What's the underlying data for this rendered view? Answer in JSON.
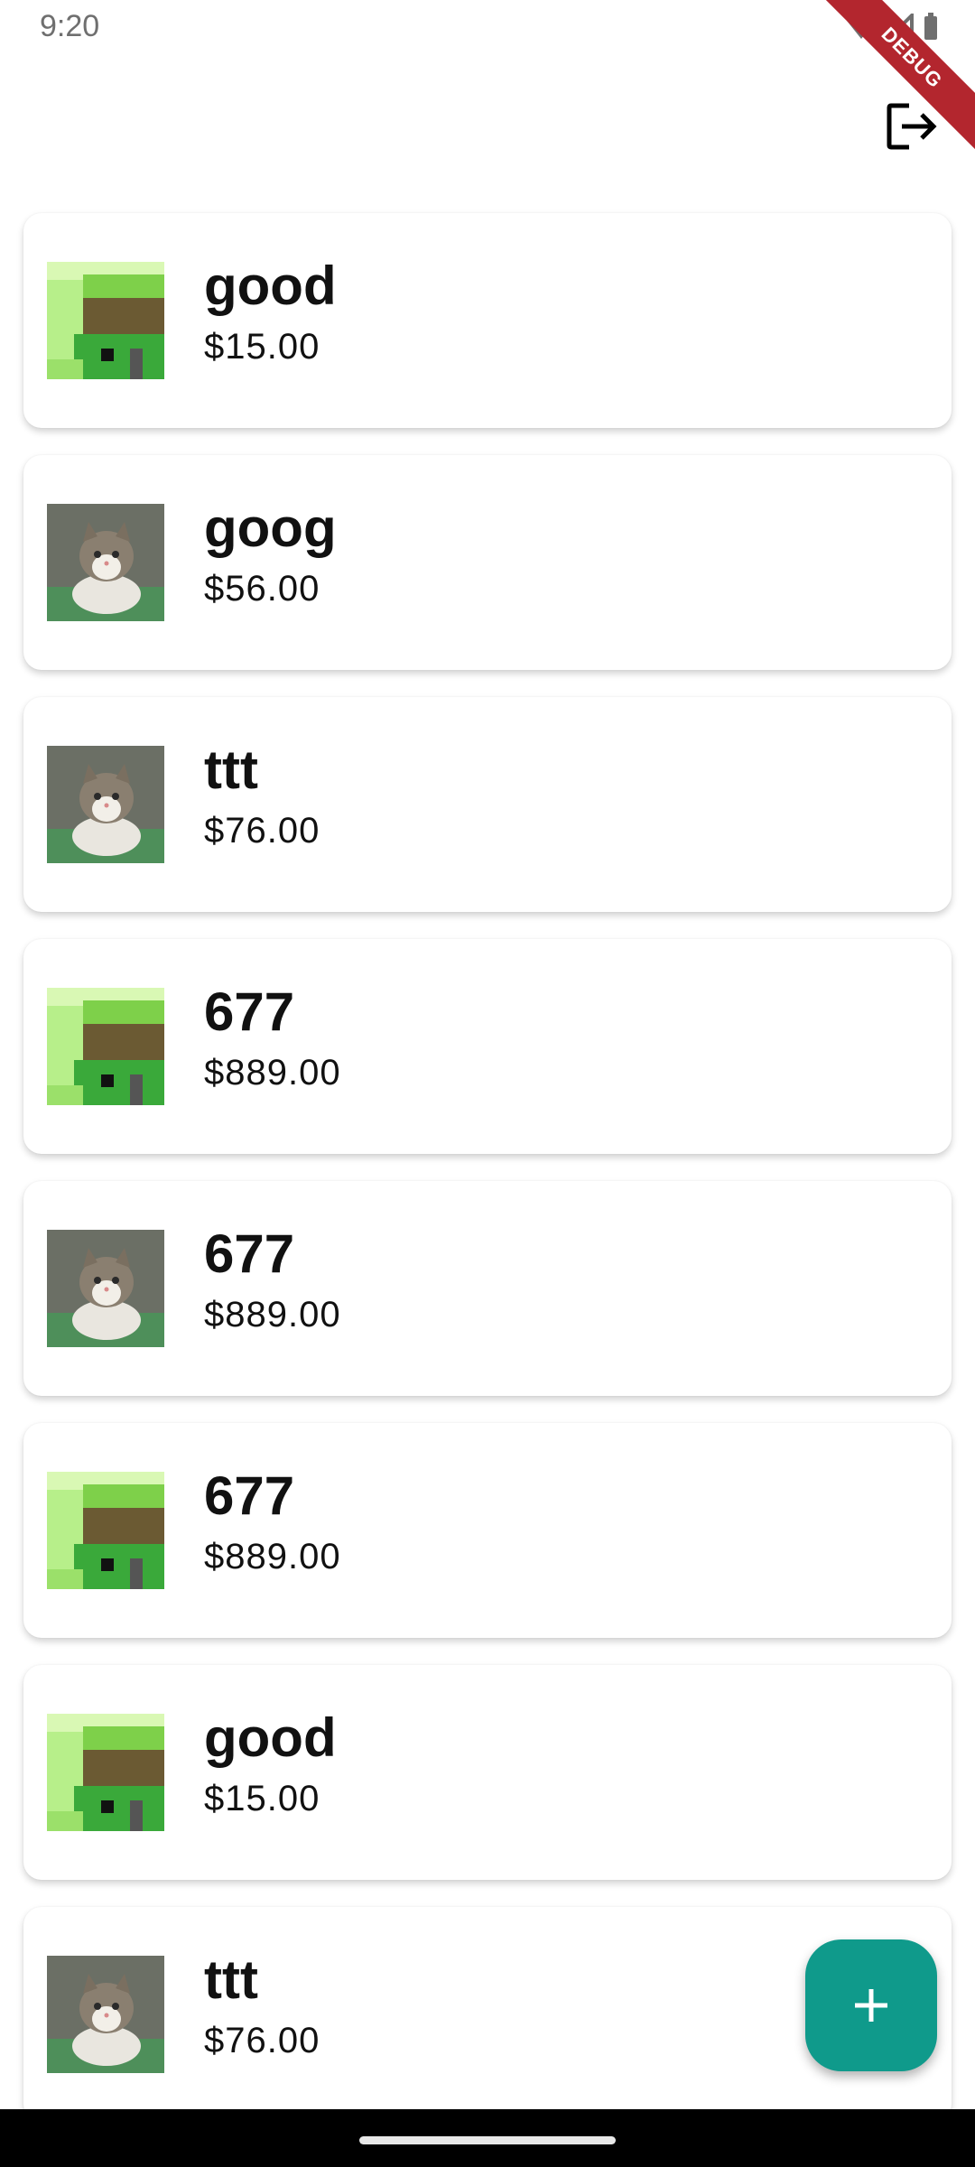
{
  "status_bar": {
    "time": "9:20",
    "debug_label": "DEBUG",
    "icons": [
      "wifi-icon",
      "signal-icon",
      "battery-icon"
    ]
  },
  "app_bar": {
    "actions": [
      "logout-icon"
    ]
  },
  "products": [
    {
      "name": "good",
      "price": "$15.00",
      "image": "pixel-art-image"
    },
    {
      "name": "goog",
      "price": "$56.00",
      "image": "cat-photo"
    },
    {
      "name": "ttt",
      "price": "$76.00",
      "image": "cat-photo"
    },
    {
      "name": "677",
      "price": "$889.00",
      "image": "pixel-art-image"
    },
    {
      "name": "677",
      "price": "$889.00",
      "image": "cat-photo"
    },
    {
      "name": "677",
      "price": "$889.00",
      "image": "pixel-art-image"
    },
    {
      "name": "good",
      "price": "$15.00",
      "image": "pixel-art-image"
    },
    {
      "name": "ttt",
      "price": "$76.00",
      "image": "cat-photo"
    }
  ],
  "fab": {
    "icon": "plus-icon",
    "color": "#0f9a8b"
  },
  "colors": {
    "background": "#ffffff",
    "card": "#ffffff",
    "accent": "#0f9a8b",
    "debug_ribbon": "#b3262e"
  }
}
